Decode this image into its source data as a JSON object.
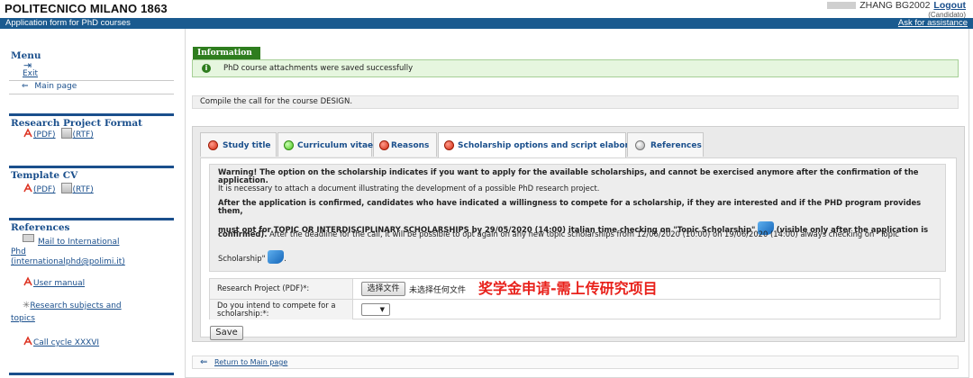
{
  "header": {
    "brand": "POLITECNICO MILANO 1863",
    "user_name": "ZHANG BG2002",
    "logout": "Logout",
    "role": "(Candidato)",
    "subtitle": "Application form for PhD courses",
    "assistance": "Ask for assistance"
  },
  "sidebar": {
    "menu_title": "Menu",
    "exit": "Exit",
    "main_page": "Main page",
    "research_format_title": "Research Project Format",
    "pdf": "(PDF)",
    "rtf": "(RTF)",
    "template_cv_title": "Template CV",
    "references_title": "References",
    "mail_line1": "Mail to International",
    "mail_line2": "Phd",
    "mail_line3": "(internationalphd@polimi.it)",
    "user_manual": "User manual",
    "research_subjects_line1": "Research subjects and",
    "research_subjects_line2": "topics",
    "call_cycle": "Call cycle XXXVI"
  },
  "information": {
    "tab_label": "Information",
    "message": "PhD course attachments were saved successfully"
  },
  "compile_text": "Compile the call for the course DESIGN.",
  "tabs": [
    {
      "label": "Study title",
      "status": "red"
    },
    {
      "label": "Curriculum vitae",
      "status": "green"
    },
    {
      "label": "Reasons",
      "status": "red"
    },
    {
      "label": "Scholarship options and script elaborate",
      "status": "red",
      "active": true
    },
    {
      "label": "References",
      "status": "grey"
    }
  ],
  "warning": {
    "bold1": "Warning! The option on the scholarship indicates if you want to apply for the available scholarships, and cannot be exercised anymore after the confirmation of the",
    "bold1b": "application.",
    "line2": "It is necessary to attach a document illustrating the development of a possible PhD research project.",
    "bold3": "After the application is confirmed, candidates who have indicated a willingness to compete for a scholarship, if they are interested and if the PHD program provides them,",
    "bold4a": "must opt for TOPIC OR INTERDISCIPLINARY SCHOLARSHIPS by 29/05/2020 (14:00) italian time checking on \"Topic Scholarship\"",
    "bold4b": "(visible only after the application is",
    "bold4c": "confirmed).",
    "line4d": "After the deadline for the call, it will be possible to opt again on any new topic scholarships from 12/06/2020 (10:00) on 19/06/2020 (14:00) always checking on \"Topic",
    "line5": "Scholarship\"",
    "line5end": "."
  },
  "form": {
    "research_label": "Research Project (PDF)*:",
    "file_button": "选择文件",
    "file_none": "未选择任何文件",
    "annotation": "奖学金申请-需上传研究项目",
    "compete_label1": "Do you intend to compete for a",
    "compete_label2": "scholarship:*:",
    "select_arrow": "▼"
  },
  "save_label": "Save",
  "return_link": "Return to Main page",
  "colors": {
    "brand_blue": "#1a5a8f",
    "link_blue": "#1a4f8c",
    "success_green": "#2e7d1e",
    "annotation_red": "#e8211b"
  }
}
